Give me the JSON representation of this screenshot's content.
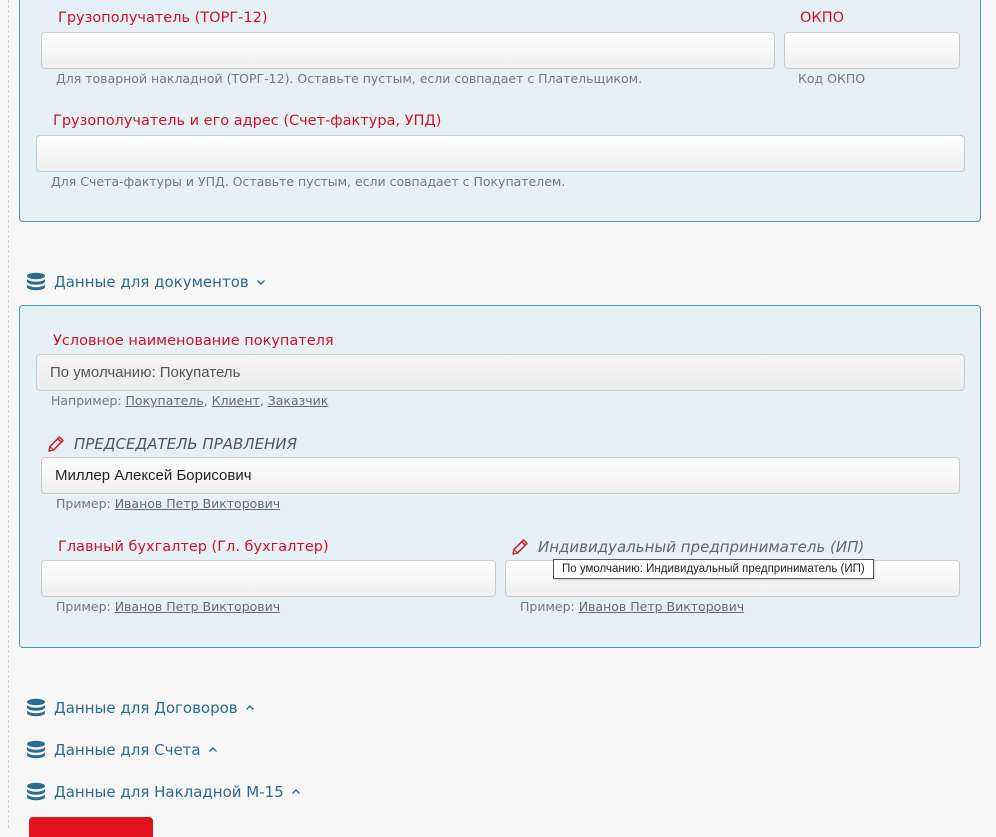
{
  "consignee_torg": {
    "label": "Грузополучатель (ТОРГ-12)",
    "value": "",
    "hint": "Для товарной накладной (ТОРГ-12). Оставьте пустым, если совпадает с Плательщиком."
  },
  "okpo": {
    "label": "ОКПО",
    "value": "",
    "hint": "Код ОКПО"
  },
  "consignee_address": {
    "label": "Грузополучатель и его адрес (Счет-фактура, УПД)",
    "value": "",
    "hint": "Для Счета-фактуры и УПД. Оставьте пустым, если совпадает с Покупателем."
  },
  "sections": {
    "documents": "Данные для документов",
    "contracts": "Данные для Договоров",
    "invoice": "Данные для Счета",
    "waybill": "Данные для Накладной М-15"
  },
  "buyer_name": {
    "label": "Условное наименование покупателя",
    "value": "По умолчанию: Покупатель",
    "hint_prefix": "Например: ",
    "examples": [
      "Покупатель",
      "Клиент",
      "Заказчик"
    ],
    "sep": ", "
  },
  "chairman": {
    "label": "ПРЕДСЕДАТЕЛЬ ПРАВЛЕНИЯ",
    "value": "Миллер Алексей Борисович",
    "hint_prefix": "Пример: ",
    "example": "Иванов Петр Викторович"
  },
  "accountant": {
    "label": "Главный бухгалтер (Гл. бухгалтер)",
    "value": "",
    "hint_prefix": "Пример: ",
    "example": "Иванов Петр Викторович"
  },
  "entrepreneur": {
    "label": "Индивидуальный предприниматель (ИП)",
    "value": "",
    "hint_prefix": "Пример: ",
    "example": "Иванов Петр Викторович",
    "tooltip": "По умолчанию: Индивидуальный предприниматель (ИП)"
  },
  "colors": {
    "label_red": "#d3102a",
    "section_blue": "#2a6b90",
    "panel_bg": "#e6f1f6",
    "panel_border": "#4a9bb5",
    "button_red": "#e2131f"
  },
  "icons": {
    "section": "database-icon",
    "edit": "pencil-icon",
    "expanded": "chevron-down-icon",
    "collapsed": "chevron-up-icon"
  }
}
